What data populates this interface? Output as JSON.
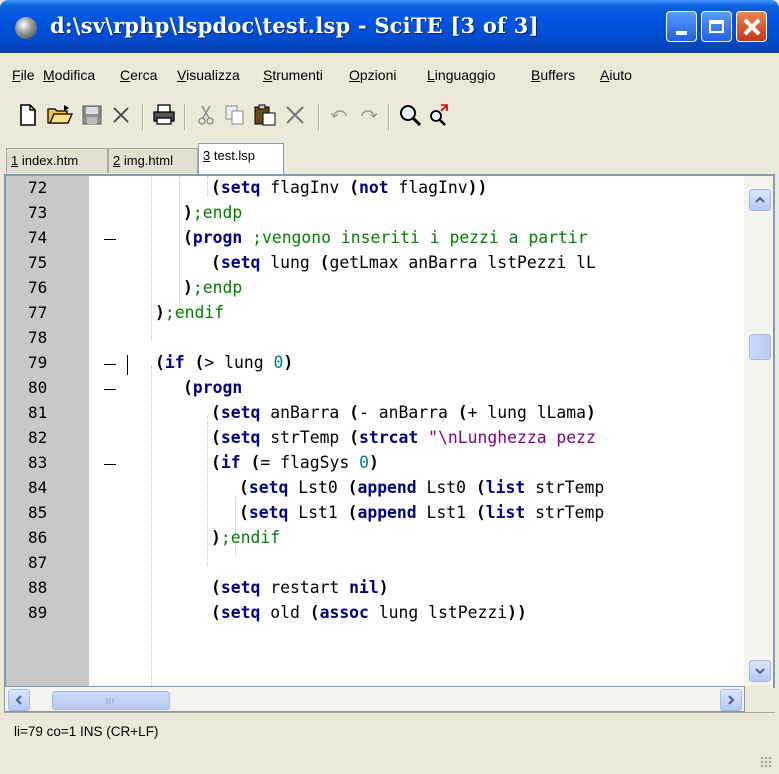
{
  "window": {
    "title": "d:\\sv\\rphp\\lspdoc\\test.lsp - SciTE [3 of 3]"
  },
  "menu": [
    {
      "mnemonic": "F",
      "rest": "ile"
    },
    {
      "mnemonic": "M",
      "rest": "odifica"
    },
    {
      "mnemonic": "C",
      "rest": "erca"
    },
    {
      "mnemonic": "V",
      "rest": "isualizza"
    },
    {
      "mnemonic": "S",
      "rest": "trumenti"
    },
    {
      "mnemonic": "O",
      "rest": "pzioni"
    },
    {
      "mnemonic": "L",
      "rest": "inguaggio"
    },
    {
      "mnemonic": "B",
      "rest": "uffers"
    },
    {
      "mnemonic": "A",
      "rest": "iuto"
    }
  ],
  "toolbar": {
    "icons": [
      "new-file-icon",
      "open-folder-icon",
      "save-icon",
      "close-icon",
      "print-icon",
      "cut-icon",
      "copy-icon",
      "paste-icon",
      "delete-icon",
      "undo-icon",
      "redo-icon",
      "find-icon",
      "replace-icon"
    ]
  },
  "tabs": [
    {
      "number": "1",
      "name": " index.htm",
      "active": false
    },
    {
      "number": "2",
      "name": " img.html",
      "active": false
    },
    {
      "number": "3",
      "name": " test.lsp",
      "active": true
    }
  ],
  "editor": {
    "lines": [
      {
        "num": "72"
      },
      {
        "num": "73"
      },
      {
        "num": "74"
      },
      {
        "num": "75"
      },
      {
        "num": "76"
      },
      {
        "num": "77"
      },
      {
        "num": "78"
      },
      {
        "num": "79"
      },
      {
        "num": "80"
      },
      {
        "num": "81"
      },
      {
        "num": "82"
      },
      {
        "num": "83"
      },
      {
        "num": "84"
      },
      {
        "num": "85"
      },
      {
        "num": "86"
      },
      {
        "num": "87"
      },
      {
        "num": "88"
      },
      {
        "num": "89"
      }
    ],
    "code": {
      "l72_kw": "setq",
      "l72_a": " flagInv ",
      "l72_kw2": "not",
      "l72_b": " flagInv",
      "l73_cmt": ";endp",
      "l74_kw": "progn",
      "l74_cmt": " ;vengono inseriti i pezzi a partir",
      "l75_kw": "setq",
      "l75_a": " lung ",
      "l75_b": "getLmax anBarra lstPezzi lL",
      "l76_cmt": ";endp",
      "l77_cmt": ";endif",
      "l79_kw": "if",
      "l79_op": ">",
      "l79_a": " lung ",
      "l79_num": "0",
      "l80_kw": "progn",
      "l81_kw": "setq",
      "l81_a": " anBarra ",
      "l81_op": "-",
      "l81_b": " anBarra ",
      "l81_op2": "+",
      "l81_c": " lung lLama",
      "l82_kw": "setq",
      "l82_a": " strTemp ",
      "l82_kw2": "strcat",
      "l82_str": "\"\\nLunghezza pezz",
      "l83_kw": "if",
      "l83_op": "=",
      "l83_a": " flagSys ",
      "l83_num": "0",
      "l84_kw": "setq",
      "l84_a": " Lst0 ",
      "l84_kw2": "append",
      "l84_b": " Lst0 ",
      "l84_kw3": "list",
      "l84_c": " strTemp",
      "l85_kw": "setq",
      "l85_a": " Lst1 ",
      "l85_kw2": "append",
      "l85_b": " Lst1 ",
      "l85_kw3": "list",
      "l85_c": " strTemp",
      "l86_cmt": ";endif",
      "l88_kw": "setq",
      "l88_a": " restart ",
      "l88_kw2": "nil",
      "l89_kw": "setq",
      "l89_a": " old ",
      "l89_kw2": "assoc",
      "l89_b": " lung lstPezzi"
    }
  },
  "statusbar": {
    "text": "li=79 co=1 INS (CR+LF)"
  },
  "colors": {
    "keyword": "#00007f",
    "comment": "#007f00",
    "string": "#7f007f",
    "number": "#007f7f",
    "margin": "#c8c8c8"
  }
}
